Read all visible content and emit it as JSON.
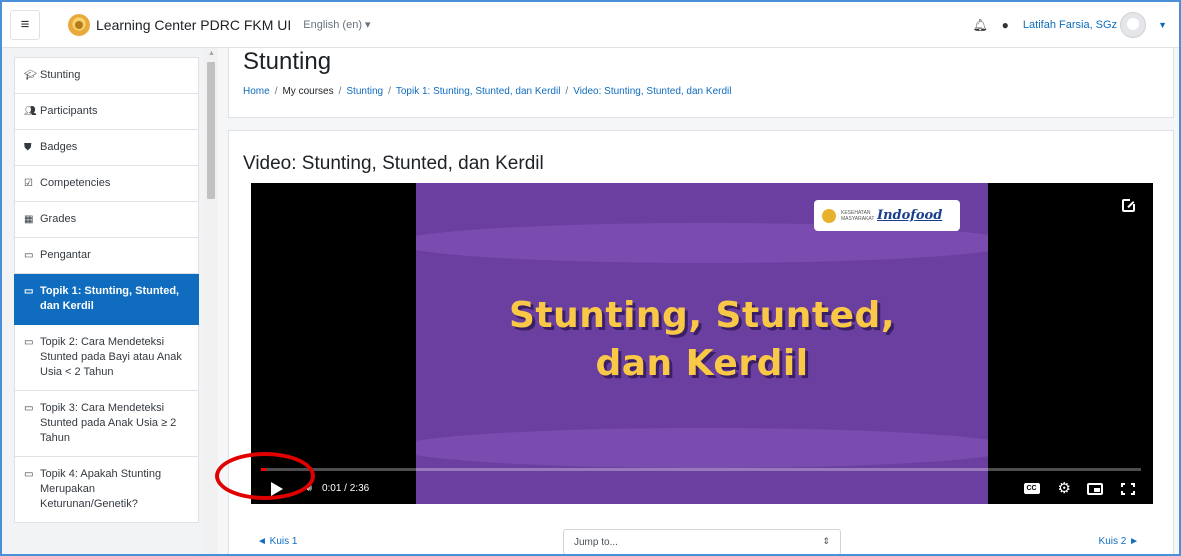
{
  "navbar": {
    "site_name": "Learning Center PDRC FKM UI",
    "language": "English (en) ▾",
    "user_name": "Latifah Farsia, SGz"
  },
  "drawer": {
    "items": [
      {
        "icon": "graduation-cap-icon",
        "label": "Stunting"
      },
      {
        "icon": "users-icon",
        "label": "Participants"
      },
      {
        "icon": "shield-icon",
        "label": "Badges"
      },
      {
        "icon": "check-square-icon",
        "label": "Competencies"
      },
      {
        "icon": "table-icon",
        "label": "Grades"
      },
      {
        "icon": "folder-icon",
        "label": "Pengantar"
      },
      {
        "icon": "folder-icon",
        "label": "Topik 1: Stunting, Stunted, dan Kerdil",
        "active": true
      },
      {
        "icon": "folder-icon",
        "label": "Topik 2: Cara Mendeteksi Stunted pada Bayi atau Anak Usia < 2 Tahun"
      },
      {
        "icon": "folder-icon",
        "label": "Topik 3: Cara Mendeteksi Stunted pada Anak Usia ≥ 2 Tahun"
      },
      {
        "icon": "folder-icon",
        "label": "Topik 4: Apakah Stunting Merupakan Keturunan/Genetik?"
      }
    ]
  },
  "header": {
    "title": "Stunting",
    "breadcrumb": [
      "Home",
      "My courses",
      "Stunting",
      "Topik 1: Stunting, Stunted, dan Kerdil",
      "Video: Stunting, Stunted, dan Kerdil"
    ]
  },
  "activity": {
    "title": "Video: Stunting, Stunted, dan Kerdil"
  },
  "video": {
    "slide_line1": "Stunting, Stunted,",
    "slide_line2": "dan Kerdil",
    "badge_small": "KESEHATAN MASYARAKAT",
    "badge_brand": "Indofood",
    "time": "0:01 / 2:36",
    "progress_fraction": 0.006,
    "cc": "CC",
    "colors": {
      "slide_bg": "#6b3fa0",
      "slide_text": "#f9c846",
      "progress": "#ff0000",
      "annotation": "#e00000"
    }
  },
  "navigation": {
    "prev": "◄ Kuis 1",
    "jump_placeholder": "Jump to...",
    "next": "Kuis 2 ►"
  }
}
